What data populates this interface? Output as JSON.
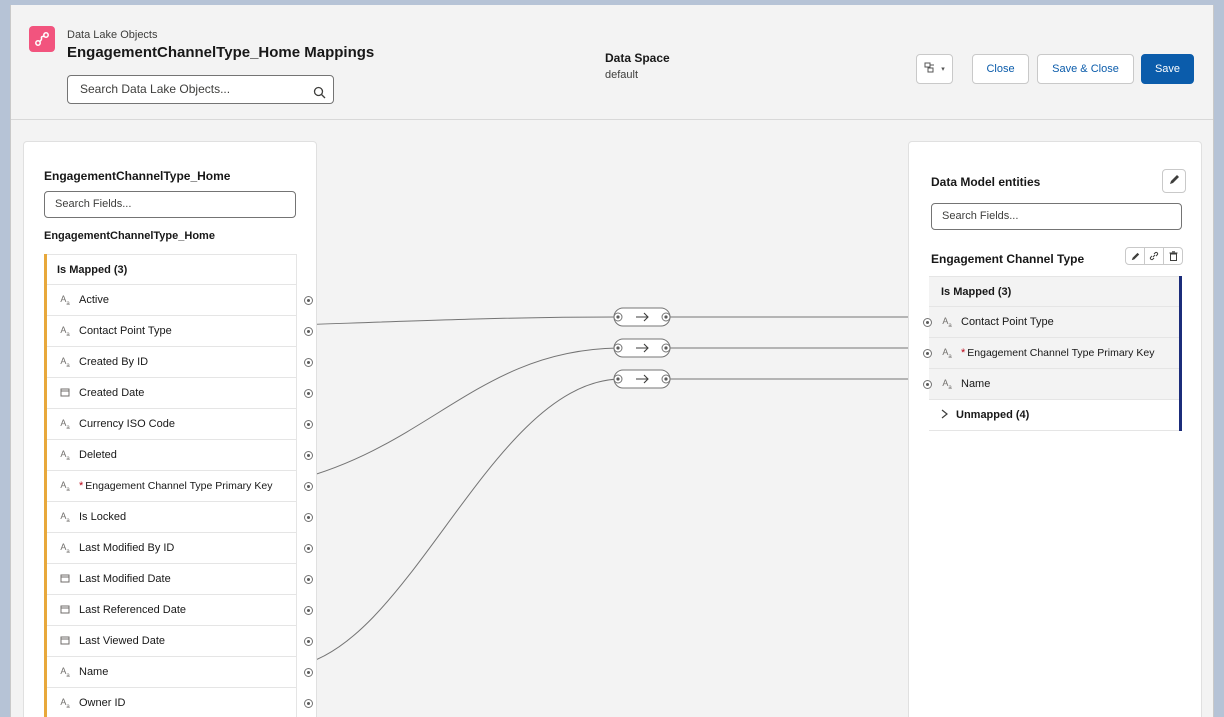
{
  "header": {
    "subtitle": "Data Lake Objects",
    "title": "EngagementChannelType_Home Mappings",
    "search_placeholder": "Search Data Lake Objects...",
    "data_space_label": "Data Space",
    "data_space_value": "default",
    "close_label": "Close",
    "save_close_label": "Save & Close",
    "save_label": "Save",
    "accent_color": "#0b5cab"
  },
  "left_panel": {
    "title": "EngagementChannelType_Home",
    "search_placeholder": "Search Fields...",
    "object_name": "EngagementChannelType_Home",
    "group_label": "Is Mapped (3)",
    "fields": [
      {
        "label": "Active",
        "icon": "text-type-icon"
      },
      {
        "label": "Contact Point Type",
        "icon": "text-type-icon"
      },
      {
        "label": "Created By ID",
        "icon": "text-type-icon"
      },
      {
        "label": "Created Date",
        "icon": "date-type-icon"
      },
      {
        "label": "Currency ISO Code",
        "icon": "text-type-icon"
      },
      {
        "label": "Deleted",
        "icon": "text-type-icon"
      },
      {
        "label": "Engagement Channel Type Primary Key",
        "icon": "text-type-icon",
        "required": "*"
      },
      {
        "label": "Is Locked",
        "icon": "text-type-icon"
      },
      {
        "label": "Last Modified By ID",
        "icon": "text-type-icon"
      },
      {
        "label": "Last Modified Date",
        "icon": "date-type-icon"
      },
      {
        "label": "Last Referenced Date",
        "icon": "date-type-icon"
      },
      {
        "label": "Last Viewed Date",
        "icon": "date-type-icon"
      },
      {
        "label": "Name",
        "icon": "text-type-icon"
      },
      {
        "label": "Owner ID",
        "icon": "text-type-icon"
      }
    ]
  },
  "right_panel": {
    "title": "Data Model entities",
    "search_placeholder": "Search Fields...",
    "entity_name": "Engagement Channel Type",
    "group_label": "Is Mapped (3)",
    "fields": [
      {
        "label": "Contact Point Type",
        "icon": "text-type-icon"
      },
      {
        "label": "Engagement Channel Type Primary Key",
        "icon": "text-type-icon",
        "required": "*"
      },
      {
        "label": "Name",
        "icon": "text-type-icon"
      }
    ],
    "unmapped_label": "Unmapped (4)"
  },
  "mappings": [
    {
      "source": "Contact Point Type",
      "target": "Contact Point Type"
    },
    {
      "source": "Engagement Channel Type Primary Key",
      "target": "Engagement Channel Type Primary Key"
    },
    {
      "source": "Name",
      "target": "Name"
    }
  ]
}
